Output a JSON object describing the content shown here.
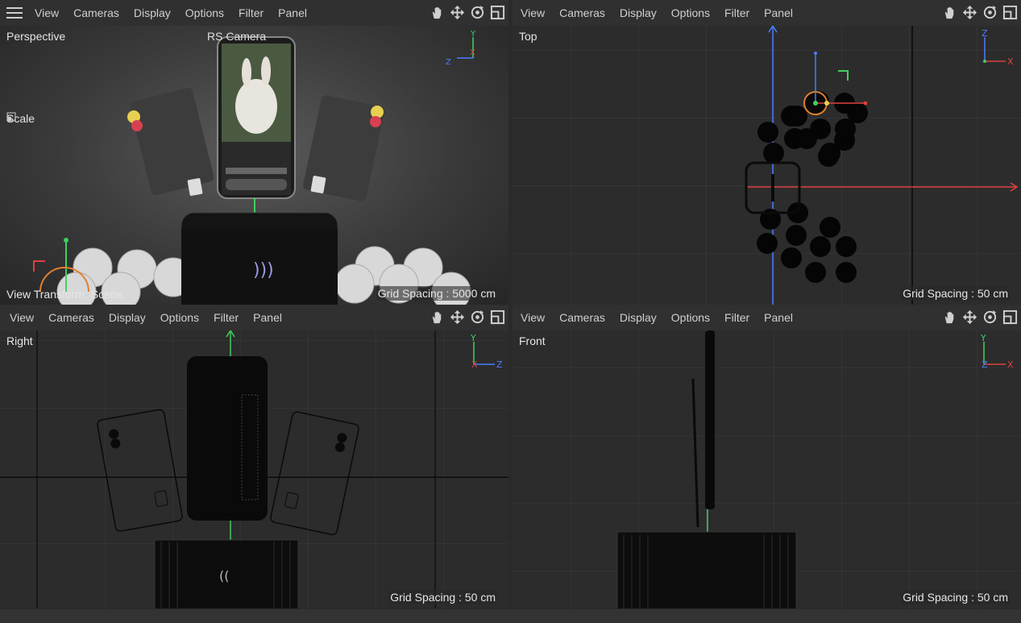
{
  "menu": [
    "View",
    "Cameras",
    "Display",
    "Options",
    "Filter",
    "Panel"
  ],
  "panes": {
    "perspective": {
      "label": "Perspective",
      "camera": "RS Camera",
      "scale": "Scale",
      "view_transform": "View Transform: Scene",
      "grid": "Grid Spacing : 5000 cm"
    },
    "top": {
      "label": "Top",
      "grid": "Grid Spacing : 50 cm"
    },
    "right": {
      "label": "Right",
      "grid": "Grid Spacing : 50 cm"
    },
    "front": {
      "label": "Front",
      "grid": "Grid Spacing : 50 cm"
    }
  },
  "icons": [
    "menu-icon",
    "hand-pan-icon",
    "move-icon",
    "rotate-icon",
    "maximize-icon"
  ],
  "colors": {
    "x_axis": "#e04040",
    "y_axis": "#40d060",
    "z_axis": "#4a7cff",
    "bg": "#2c2c2c"
  }
}
